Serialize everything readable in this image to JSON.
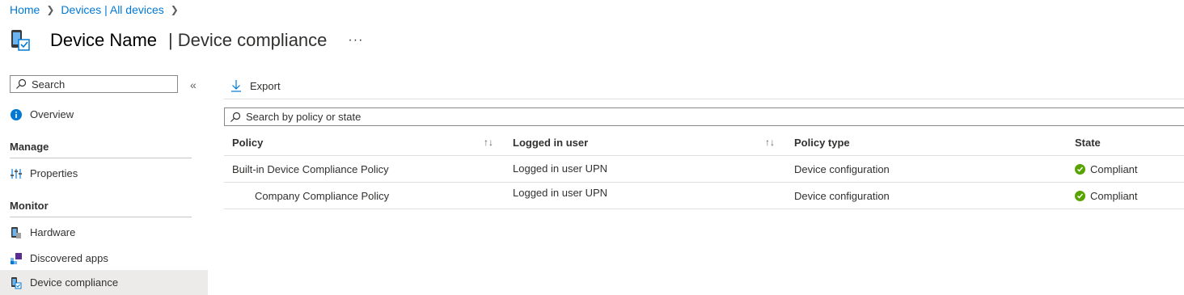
{
  "breadcrumb": {
    "home": "Home",
    "devices": "Devices | All devices"
  },
  "header": {
    "device_name": "Device Name",
    "separator": "|",
    "blade_title": "Device compliance",
    "more": "···"
  },
  "sidebar": {
    "search_placeholder": "Search",
    "collapse_glyph": "«",
    "overview": "Overview",
    "manage_heading": "Manage",
    "properties": "Properties",
    "monitor_heading": "Monitor",
    "hardware": "Hardware",
    "discovered_apps": "Discovered apps",
    "device_compliance": "Device compliance"
  },
  "toolbar": {
    "export_label": "Export"
  },
  "filter": {
    "placeholder": "Search by policy or state"
  },
  "table": {
    "columns": [
      "Policy",
      "Logged in user",
      "Policy type",
      "State"
    ],
    "sort_glyph": "↑↓",
    "rows": [
      {
        "policy": "Built-in Device Compliance Policy",
        "user": "Logged in user UPN",
        "type": "Device configuration",
        "state": "Compliant"
      },
      {
        "policy": "Company Compliance Policy",
        "user": "Logged in user UPN",
        "type": "Device configuration",
        "state": "Compliant"
      }
    ]
  },
  "colors": {
    "accent": "#0078d4",
    "compliant": "#57a300",
    "selected_bg": "#edebe9"
  }
}
